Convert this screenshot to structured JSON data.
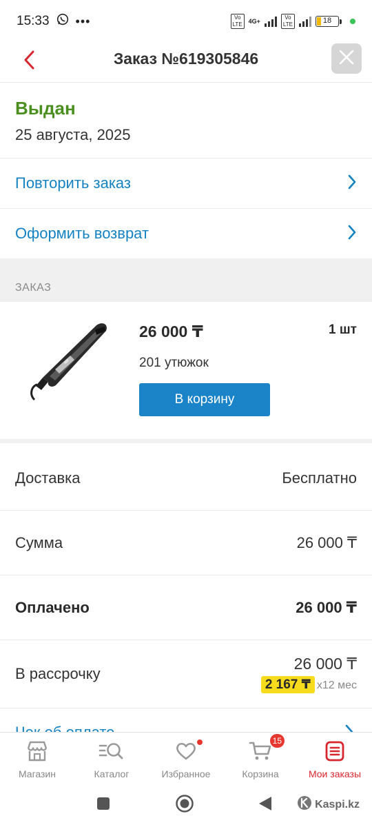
{
  "status_bar": {
    "time": "15:33",
    "icons": [
      "whatsapp-icon",
      "more-dots-icon"
    ],
    "network": "4G+",
    "battery": "18"
  },
  "header": {
    "title": "Заказ №619305846",
    "back_icon": "chevron-left-icon",
    "close_icon": "close-icon"
  },
  "order": {
    "status": "Выдан",
    "status_color": "#4a8f1f",
    "date": "25 августа, 2025"
  },
  "actions": [
    {
      "label": "Повторить заказ"
    },
    {
      "label": "Оформить возврат"
    }
  ],
  "section_label": "ЗАКАЗ",
  "product": {
    "price": "26 000 ₸",
    "quantity": "1 шт",
    "name": "201 утюжок",
    "cart_button": "В корзину"
  },
  "summary": {
    "delivery": {
      "label": "Доставка",
      "value": "Бесплатно"
    },
    "sum": {
      "label": "Сумма",
      "value": "26 000 ₸"
    },
    "paid": {
      "label": "Оплачено",
      "value": "26 000 ₸"
    },
    "installment": {
      "label": "В рассрочку",
      "value": "26 000 ₸",
      "monthly": "2 167 ₸",
      "term": "x12 мес"
    }
  },
  "receipt": {
    "label": "Чек об оплате"
  },
  "tabbar": {
    "items": [
      {
        "label": "Магазин",
        "icon": "shop-icon"
      },
      {
        "label": "Каталог",
        "icon": "catalog-search-icon"
      },
      {
        "label": "Избранное",
        "icon": "heart-icon"
      },
      {
        "label": "Корзина",
        "icon": "cart-icon",
        "badge": "15"
      },
      {
        "label": "Мои заказы",
        "icon": "orders-icon"
      }
    ],
    "active_color": "#d8262f"
  },
  "system_nav": {
    "watermark": "Kaspi.kz"
  },
  "colors": {
    "link": "#1583c1",
    "primary_button": "#1b84c8",
    "installment_chip": "#f7dc1e"
  }
}
